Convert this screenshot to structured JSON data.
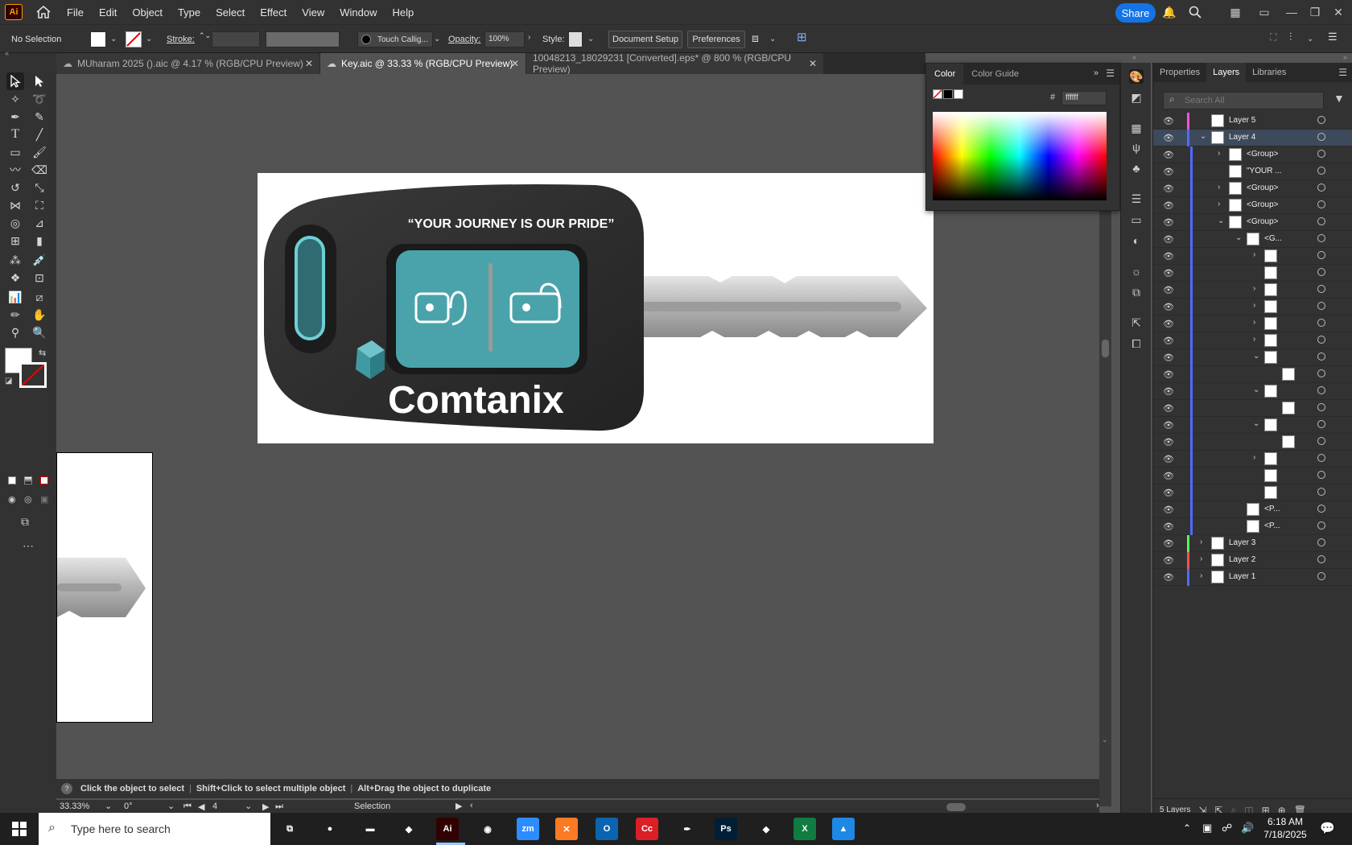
{
  "app": {
    "logo": "Ai",
    "menu": [
      "File",
      "Edit",
      "Object",
      "Type",
      "Select",
      "Effect",
      "View",
      "Window",
      "Help"
    ],
    "share_label": "Share",
    "top_icons": [
      "bell-icon",
      "search-icon",
      "arrange-icon",
      "layout-icon",
      "minimize-icon",
      "restore-icon",
      "close-icon"
    ]
  },
  "control_bar": {
    "selection_label": "No Selection",
    "stroke_label": "Stroke:",
    "brush_label": "Touch Callig...",
    "opacity_label": "Opacity:",
    "opacity_value": "100%",
    "style_label": "Style:",
    "document_setup": "Document Setup",
    "preferences": "Preferences"
  },
  "tabs": [
    {
      "label": "MUharam 2025 ().aic @ 4.17 % (RGB/CPU Preview)",
      "active": false
    },
    {
      "label": "Key.aic @ 33.33 % (RGB/CPU Preview)",
      "active": true
    },
    {
      "label": "10048213_18029231 [Converted].eps* @ 800 % (RGB/CPU Preview)",
      "active": false
    }
  ],
  "artwork": {
    "slogan": "“YOUR JOURNEY IS OUR PRIDE”",
    "brand": "Comtanix",
    "accent": "#4aa3ab",
    "dark": "#2a2a2a"
  },
  "color_panel": {
    "tabs": [
      "Color",
      "Color Guide"
    ],
    "hex_label": "#",
    "hex_value": "ffffff"
  },
  "layers_panel": {
    "tabs": [
      "Properties",
      "Layers",
      "Libraries"
    ],
    "search_placeholder": "Search All",
    "footer_count": "5 Layers",
    "rows": [
      {
        "name": "Layer 5",
        "indent": 0,
        "twirl": "",
        "color": "#ff4fd8",
        "sel": false
      },
      {
        "name": "Layer 4",
        "indent": 0,
        "twirl": "v",
        "color": "#4f6bff",
        "sel": true
      },
      {
        "name": "<Group>",
        "indent": 1,
        "twirl": ">",
        "color": "#4f6bff",
        "sel": false
      },
      {
        "name": "\"YOUR ...",
        "indent": 1,
        "twirl": "",
        "color": "#4f6bff",
        "sel": false
      },
      {
        "name": "<Group>",
        "indent": 1,
        "twirl": ">",
        "color": "#4f6bff",
        "sel": false
      },
      {
        "name": "<Group>",
        "indent": 1,
        "twirl": ">",
        "color": "#4f6bff",
        "sel": false
      },
      {
        "name": "<Group>",
        "indent": 1,
        "twirl": "v",
        "color": "#4f6bff",
        "sel": false
      },
      {
        "name": "<G...",
        "indent": 2,
        "twirl": "v",
        "color": "#4f6bff",
        "sel": false
      },
      {
        "name": "",
        "indent": 3,
        "twirl": ">",
        "color": "#4f6bff",
        "sel": false
      },
      {
        "name": "",
        "indent": 3,
        "twirl": "",
        "color": "#4f6bff",
        "sel": false
      },
      {
        "name": "",
        "indent": 3,
        "twirl": ">",
        "color": "#4f6bff",
        "sel": false
      },
      {
        "name": "",
        "indent": 3,
        "twirl": ">",
        "color": "#4f6bff",
        "sel": false
      },
      {
        "name": "",
        "indent": 3,
        "twirl": ">",
        "color": "#4f6bff",
        "sel": false
      },
      {
        "name": "",
        "indent": 3,
        "twirl": ">",
        "color": "#4f6bff",
        "sel": false
      },
      {
        "name": "",
        "indent": 3,
        "twirl": "v",
        "color": "#4f6bff",
        "sel": false
      },
      {
        "name": "",
        "indent": 4,
        "twirl": "",
        "color": "#4f6bff",
        "sel": false
      },
      {
        "name": "",
        "indent": 3,
        "twirl": "v",
        "color": "#4f6bff",
        "sel": false
      },
      {
        "name": "",
        "indent": 4,
        "twirl": "",
        "color": "#4f6bff",
        "sel": false
      },
      {
        "name": "",
        "indent": 3,
        "twirl": "v",
        "color": "#4f6bff",
        "sel": false
      },
      {
        "name": "",
        "indent": 4,
        "twirl": "",
        "color": "#4f6bff",
        "sel": false
      },
      {
        "name": "",
        "indent": 3,
        "twirl": ">",
        "color": "#4f6bff",
        "sel": false
      },
      {
        "name": "",
        "indent": 3,
        "twirl": "",
        "color": "#4f6bff",
        "sel": false
      },
      {
        "name": "",
        "indent": 3,
        "twirl": "",
        "color": "#4f6bff",
        "sel": false
      },
      {
        "name": "<P...",
        "indent": 2,
        "twirl": "",
        "color": "#4f6bff",
        "sel": false
      },
      {
        "name": "<P...",
        "indent": 2,
        "twirl": "",
        "color": "#4f6bff",
        "sel": false
      },
      {
        "name": "Layer 3",
        "indent": 0,
        "twirl": ">",
        "color": "#4fff4f",
        "sel": false
      },
      {
        "name": "Layer 2",
        "indent": 0,
        "twirl": ">",
        "color": "#ff4f4f",
        "sel": false
      },
      {
        "name": "Layer 1",
        "indent": 0,
        "twirl": ">",
        "color": "#4f6bff",
        "sel": false
      }
    ]
  },
  "status": {
    "hint1": "Click the object to select",
    "hint2": "Shift+Click to select multiple object",
    "hint3": "Alt+Drag the object to duplicate",
    "zoom": "33.33%",
    "rotation": "0°",
    "artboard_num": "4",
    "tool_name": "Selection"
  },
  "taskbar": {
    "search_placeholder": "Type here to search",
    "time": "6:18 AM",
    "date": "7/18/2025",
    "apps": [
      {
        "name": "task-view-icon",
        "label": "⧉",
        "bg": "transparent"
      },
      {
        "name": "firefox-icon",
        "label": "●",
        "bg": "transparent"
      },
      {
        "name": "file-explorer-icon",
        "label": "▬",
        "bg": "transparent"
      },
      {
        "name": "vscode-icon",
        "label": "◆",
        "bg": "transparent"
      },
      {
        "name": "illustrator-icon",
        "label": "Ai",
        "bg": "#330000"
      },
      {
        "name": "chrome-icon",
        "label": "◉",
        "bg": "transparent"
      },
      {
        "name": "zoom-icon",
        "label": "zm",
        "bg": "#2d8cff"
      },
      {
        "name": "xampp-icon",
        "label": "✕",
        "bg": "#fb7a24"
      },
      {
        "name": "outlook-icon",
        "label": "O",
        "bg": "#0a64b0"
      },
      {
        "name": "creative-cloud-icon",
        "label": "Cc",
        "bg": "#da1f26"
      },
      {
        "name": "pen-tool-icon",
        "label": "✒",
        "bg": "transparent"
      },
      {
        "name": "photoshop-icon",
        "label": "Ps",
        "bg": "#001e36"
      },
      {
        "name": "app-diamond-icon",
        "label": "◆",
        "bg": "transparent"
      },
      {
        "name": "excel-icon",
        "label": "X",
        "bg": "#107c41"
      },
      {
        "name": "paint-icon",
        "label": "▲",
        "bg": "#1e88e5"
      }
    ]
  }
}
